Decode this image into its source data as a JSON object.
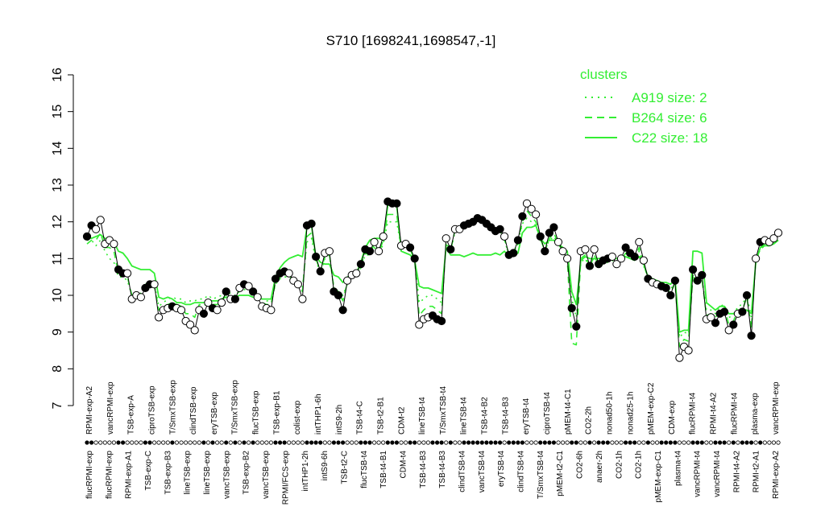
{
  "chart_data": {
    "type": "line",
    "title": "S710 [1698241,1698547,-1]",
    "xlabel": "",
    "ylabel": "",
    "ylim": [
      7,
      16
    ],
    "yticks": [
      7,
      8,
      9,
      10,
      11,
      12,
      13,
      14,
      15,
      16
    ],
    "grid": false,
    "legend": {
      "title": "clusters",
      "placement": "top-right",
      "entries": [
        {
          "label": "A919 size: 2",
          "style": "dotted"
        },
        {
          "label": "B264 size: 6",
          "style": "dashed"
        },
        {
          "label": "C22 size: 18",
          "style": "solid"
        }
      ]
    },
    "colors": {
      "cluster": "#33ee33",
      "points_filled": "#000000",
      "points_open": "#ffffff"
    },
    "xticks_top": [
      "RPMI-exp-A2",
      "vancRPMI-exp",
      "TSB-exp-A",
      "ciproTSB-exp",
      "T/SmxTSB-exp",
      "clindTSB-exp",
      "eryTSB-exp",
      "T/SmxTSB-exp",
      "flucTSB-exp",
      "TSB-exp-B1",
      "colist-exp",
      "intTHP1-6h",
      "intS9-2h",
      "TSB-t4-C",
      "TSB-t2-B1",
      "CDM-t2",
      "lineTSB-t4",
      "T/SmxTSB-t4",
      "lineTSB-t4",
      "TSB-t4-B2",
      "TSB-t4-B3",
      "eryTSB-t4",
      "ciproTSB-t4",
      "pMEM-t4-C1",
      "CO2-2h",
      "nonad50-1h",
      "nonad25-1h",
      "pMEM-exp-C2",
      "CDM-exp",
      "flucRPMI-t4",
      "RPMI-t4-A2",
      "flucRPMI-t4",
      "plasma-exp",
      "vancRPMI-exp"
    ],
    "xticks_bottom": [
      "flucRPMI-exp",
      "flucRPMI-exp",
      "RPMI-exp-A1",
      "TSB-exp-C",
      "TSB-exp-B3",
      "lineTSB-exp",
      "lineTSB-exp",
      "vancTSB-exp",
      "TSB-exp-B2",
      "vancTSB-exp",
      "RPMI/FCS-exp",
      "intTHP1-2h",
      "intS9-6h",
      "TSB-t2-C",
      "flucTSB-t4",
      "TSB-t4-B1",
      "CDM-t4",
      "TSB-t4-B3",
      "TSB-t4-B3",
      "clindTSB-t4",
      "vancTSB-t4",
      "eryTSB-t4",
      "clindTSB-t4",
      "T/SmxTSB-t4",
      "pMEM-t2-C1",
      "CO2-6h",
      "anaer-2h",
      "CO2-1h",
      "CO2-1h",
      "pMEM-exp-C1",
      "plasma-t4",
      "vancRPMI-t4",
      "vancRPMI-t4",
      "RPMI-t4-A2",
      "RPMI-t2-A1",
      "RPMI-exp-A2"
    ],
    "series": [
      {
        "values": [
          11.6,
          11.9,
          11.8,
          12.05,
          11.4,
          11.5,
          11.4,
          10.7,
          10.6,
          10.6,
          9.9,
          10.0,
          9.95,
          10.2,
          10.3,
          10.3,
          9.4,
          9.6,
          9.65,
          9.7,
          9.65,
          9.6,
          9.3,
          9.2,
          9.05,
          9.6,
          9.5,
          9.8,
          9.65,
          9.6,
          9.8,
          10.1,
          9.9,
          9.9,
          10.2,
          10.3,
          10.25,
          10.1,
          9.95,
          9.7,
          9.65,
          9.6,
          10.45,
          10.6,
          10.65,
          10.6,
          10.4,
          10.3,
          9.9,
          11.9,
          11.95,
          11.05,
          10.65,
          11.15,
          11.2,
          10.1,
          10.0,
          9.6,
          10.4,
          10.55,
          10.6,
          10.85,
          11.25,
          11.2,
          11.45,
          11.2,
          11.6,
          12.55,
          12.5,
          12.5,
          11.35,
          11.4,
          11.3,
          11.0,
          9.2,
          9.35,
          9.4,
          9.45,
          9.35,
          9.3,
          11.55,
          11.25,
          11.8,
          11.8,
          11.9,
          11.95,
          12.0,
          12.1,
          12.05,
          11.95,
          11.85,
          11.75,
          11.8,
          11.6,
          11.1,
          11.15,
          11.5,
          12.15,
          12.5,
          12.35,
          12.2,
          11.6,
          11.2,
          11.7,
          11.85,
          11.45,
          11.2,
          11.0,
          9.65,
          9.15,
          11.2,
          11.25,
          10.8,
          11.25,
          10.85,
          10.95,
          11.0,
          11.05,
          10.85,
          11.0,
          11.3,
          11.15,
          11.05,
          11.45,
          10.95,
          10.45,
          10.35,
          10.3,
          10.25,
          10.2,
          10.0,
          10.4,
          8.3,
          8.6,
          8.5,
          10.7,
          10.4,
          10.55,
          9.35,
          9.4,
          9.25,
          9.5,
          9.55,
          9.05,
          9.2,
          9.5,
          9.55,
          10.0,
          8.9,
          11.0,
          11.45,
          11.5,
          11.45,
          11.55,
          11.7
        ]
      },
      {
        "name": "A919 size: 2",
        "values": [
          11.5,
          11.5,
          11.35,
          11.5,
          11.2,
          11.0,
          10.9,
          10.5,
          10.5,
          10.4,
          10.0,
          10.1,
          10.05,
          10.3,
          10.35,
          10.3,
          9.7,
          9.8,
          9.9,
          9.95,
          9.9,
          9.9,
          9.8,
          9.85,
          9.85,
          9.9,
          9.9,
          10.0,
          9.9,
          9.95,
          10.0,
          10.1,
          10.05,
          10.0,
          10.1,
          10.15,
          10.2,
          10.0,
          9.95,
          9.9,
          9.85,
          9.85,
          10.3,
          10.45,
          10.5,
          10.5,
          10.4,
          10.3,
          10.2,
          11.45,
          11.55,
          10.95,
          10.6,
          11.0,
          11.1,
          10.2,
          10.1,
          10.0,
          10.3,
          10.5,
          10.55,
          10.75,
          11.1,
          11.1,
          11.3,
          11.1,
          11.4,
          12.0,
          12.0,
          12.0,
          11.3,
          11.35,
          11.25,
          11.0,
          9.8,
          9.9,
          10.0,
          10.0,
          9.9,
          9.8,
          11.4,
          11.2,
          11.75,
          11.8,
          11.95,
          11.95,
          12.0,
          12.05,
          12.05,
          11.95,
          11.85,
          11.8,
          11.7,
          11.5,
          11.1,
          11.15,
          11.4,
          11.95,
          12.1,
          12.0,
          11.9,
          11.5,
          11.25,
          11.5,
          11.6,
          11.4,
          11.2,
          11.0,
          9.9,
          9.4,
          10.9,
          11.0,
          10.75,
          11.05,
          10.8,
          10.85,
          10.9,
          10.95,
          10.85,
          10.9,
          11.1,
          11.0,
          10.95,
          11.2,
          10.8,
          10.5,
          10.4,
          10.35,
          10.3,
          10.25,
          10.15,
          10.4,
          8.85,
          9.0,
          8.95,
          10.5,
          10.4,
          10.45,
          9.6,
          9.6,
          9.5,
          9.7,
          9.75,
          9.4,
          9.45,
          9.7,
          9.75,
          10.0,
          9.4,
          10.95,
          11.25,
          11.35,
          11.35,
          11.4,
          11.5
        ]
      },
      {
        "name": "B264 size: 6",
        "values": [
          11.4,
          11.5,
          11.5,
          11.7,
          11.3,
          11.3,
          11.2,
          10.6,
          10.6,
          10.5,
          10.0,
          10.05,
          10.0,
          10.25,
          10.3,
          10.25,
          9.6,
          9.7,
          9.75,
          9.8,
          9.75,
          9.7,
          9.5,
          9.5,
          9.4,
          9.75,
          9.7,
          9.85,
          9.75,
          9.75,
          9.85,
          10.05,
          9.95,
          9.95,
          10.15,
          10.2,
          10.2,
          10.05,
          9.95,
          9.8,
          9.75,
          9.75,
          10.35,
          10.5,
          10.55,
          10.55,
          10.4,
          10.3,
          10.1,
          11.6,
          11.7,
          11.0,
          10.65,
          11.05,
          11.1,
          10.2,
          10.1,
          9.85,
          10.35,
          10.5,
          10.55,
          10.8,
          11.15,
          11.1,
          11.4,
          11.15,
          11.5,
          12.2,
          12.2,
          12.2,
          11.3,
          11.35,
          11.25,
          10.95,
          9.45,
          9.6,
          9.7,
          9.7,
          9.6,
          9.5,
          11.45,
          11.2,
          11.8,
          11.8,
          11.95,
          11.95,
          12.0,
          12.1,
          12.05,
          11.95,
          11.85,
          11.75,
          11.75,
          11.55,
          11.1,
          11.15,
          11.45,
          12.0,
          12.3,
          12.15,
          12.0,
          11.55,
          11.2,
          11.55,
          11.7,
          11.4,
          11.2,
          11.0,
          8.7,
          8.65,
          11.0,
          11.1,
          10.75,
          11.1,
          10.8,
          10.9,
          10.95,
          11.0,
          10.85,
          10.95,
          11.15,
          11.05,
          11.0,
          11.3,
          10.85,
          10.45,
          10.35,
          10.3,
          10.25,
          10.2,
          10.05,
          10.35,
          8.6,
          8.8,
          8.75,
          10.55,
          10.35,
          10.45,
          9.45,
          9.5,
          9.4,
          9.6,
          9.65,
          9.2,
          9.3,
          9.6,
          9.6,
          9.95,
          9.1,
          10.95,
          11.3,
          11.4,
          11.4,
          11.45,
          11.6
        ]
      },
      {
        "name": "C22 size: 18",
        "values": [
          11.6,
          11.55,
          11.6,
          11.65,
          11.55,
          11.5,
          11.45,
          11.2,
          11.15,
          11.0,
          10.8,
          10.75,
          10.7,
          10.7,
          10.7,
          10.6,
          9.95,
          9.9,
          9.95,
          9.9,
          9.8,
          9.8,
          9.75,
          9.75,
          9.8,
          9.8,
          9.8,
          9.85,
          9.85,
          9.85,
          9.9,
          9.95,
          9.95,
          9.95,
          10.0,
          10.0,
          10.0,
          9.95,
          9.95,
          9.9,
          9.9,
          9.9,
          10.5,
          10.75,
          10.9,
          11.0,
          11.05,
          11.1,
          11.05,
          11.85,
          11.9,
          11.05,
          10.9,
          10.85,
          10.85,
          10.55,
          10.5,
          10.35,
          10.5,
          10.55,
          10.6,
          10.9,
          11.3,
          11.5,
          11.55,
          11.55,
          11.5,
          12.45,
          12.45,
          12.45,
          11.2,
          11.15,
          11.1,
          10.95,
          10.25,
          10.2,
          10.2,
          10.15,
          10.1,
          10.05,
          11.3,
          11.1,
          11.1,
          11.1,
          11.05,
          11.1,
          11.15,
          11.1,
          11.1,
          11.1,
          11.1,
          11.15,
          11.1,
          11.2,
          11.05,
          11.1,
          11.15,
          11.7,
          11.85,
          11.85,
          11.9,
          11.55,
          11.4,
          11.5,
          11.5,
          11.4,
          11.3,
          11.2,
          10.1,
          9.75,
          10.95,
          11.05,
          11.0,
          11.0,
          11.0,
          11.0,
          11.0,
          11.0,
          11.0,
          11.0,
          11.05,
          11.0,
          10.95,
          11.05,
          10.85,
          10.5,
          10.45,
          10.4,
          10.35,
          10.35,
          10.3,
          10.45,
          9.0,
          9.05,
          9.05,
          11.2,
          11.2,
          11.15,
          9.8,
          9.7,
          9.6,
          9.7,
          9.7,
          9.5,
          9.5,
          9.6,
          9.6,
          9.6,
          9.5,
          10.9,
          11.3,
          11.35,
          11.35,
          11.4,
          11.5
        ]
      }
    ],
    "points": {
      "values": [
        11.6,
        11.9,
        11.8,
        12.05,
        11.4,
        11.5,
        11.4,
        10.7,
        10.6,
        10.6,
        9.9,
        10.0,
        9.95,
        10.2,
        10.3,
        10.3,
        9.4,
        9.6,
        9.65,
        9.7,
        9.65,
        9.6,
        9.3,
        9.2,
        9.05,
        9.6,
        9.5,
        9.8,
        9.65,
        9.6,
        9.8,
        10.1,
        9.9,
        9.9,
        10.2,
        10.3,
        10.25,
        10.1,
        9.95,
        9.7,
        9.65,
        9.6,
        10.45,
        10.6,
        10.65,
        10.6,
        10.4,
        10.3,
        9.9,
        11.9,
        11.95,
        11.05,
        10.65,
        11.15,
        11.2,
        10.1,
        10.0,
        9.6,
        10.4,
        10.55,
        10.6,
        10.85,
        11.25,
        11.2,
        11.45,
        11.2,
        11.6,
        12.55,
        12.5,
        12.5,
        11.35,
        11.4,
        11.3,
        11.0,
        9.2,
        9.35,
        9.4,
        9.45,
        9.35,
        9.3,
        11.55,
        11.25,
        11.8,
        11.8,
        11.9,
        11.95,
        12.0,
        12.1,
        12.05,
        11.95,
        11.85,
        11.75,
        11.8,
        11.6,
        11.1,
        11.15,
        11.5,
        12.15,
        12.5,
        12.35,
        12.2,
        11.6,
        11.2,
        11.7,
        11.85,
        11.45,
        11.2,
        11.0,
        9.65,
        9.15,
        11.2,
        11.25,
        10.8,
        11.25,
        10.85,
        10.95,
        11.0,
        11.05,
        10.85,
        11.0,
        11.3,
        11.15,
        11.05,
        11.45,
        10.95,
        10.45,
        10.35,
        10.3,
        10.25,
        10.2,
        10.0,
        10.4,
        8.3,
        8.6,
        8.5,
        10.7,
        10.4,
        10.55,
        9.35,
        9.4,
        9.25,
        9.5,
        9.55,
        9.05,
        9.2,
        9.5,
        9.55,
        10.0,
        8.9,
        11.0,
        11.45,
        11.5,
        11.45,
        11.55,
        11.7
      ],
      "filled": [
        1,
        1,
        0,
        0,
        0,
        0,
        0,
        1,
        1,
        0,
        0,
        0,
        0,
        1,
        1,
        0,
        0,
        0,
        0,
        1,
        0,
        0,
        0,
        0,
        0,
        0,
        1,
        0,
        1,
        0,
        0,
        1,
        0,
        1,
        0,
        1,
        0,
        1,
        0,
        0,
        0,
        0,
        1,
        1,
        1,
        0,
        0,
        0,
        0,
        1,
        1,
        1,
        1,
        0,
        0,
        1,
        1,
        1,
        0,
        0,
        0,
        1,
        1,
        1,
        0,
        0,
        0,
        1,
        1,
        1,
        0,
        0,
        1,
        1,
        0,
        0,
        0,
        1,
        1,
        1,
        0,
        1,
        0,
        0,
        1,
        1,
        1,
        1,
        1,
        1,
        1,
        1,
        1,
        0,
        1,
        1,
        1,
        1,
        0,
        0,
        0,
        1,
        1,
        1,
        1,
        0,
        0,
        0,
        1,
        1,
        0,
        0,
        1,
        0,
        1,
        1,
        1,
        0,
        0,
        0,
        1,
        1,
        1,
        0,
        0,
        1,
        0,
        0,
        1,
        1,
        1,
        1,
        0,
        0,
        0,
        1,
        1,
        1,
        0,
        0,
        1,
        1,
        1,
        0,
        1,
        0,
        1,
        1,
        1,
        0,
        1,
        0,
        0,
        0,
        0,
        1,
        0
      ]
    }
  }
}
